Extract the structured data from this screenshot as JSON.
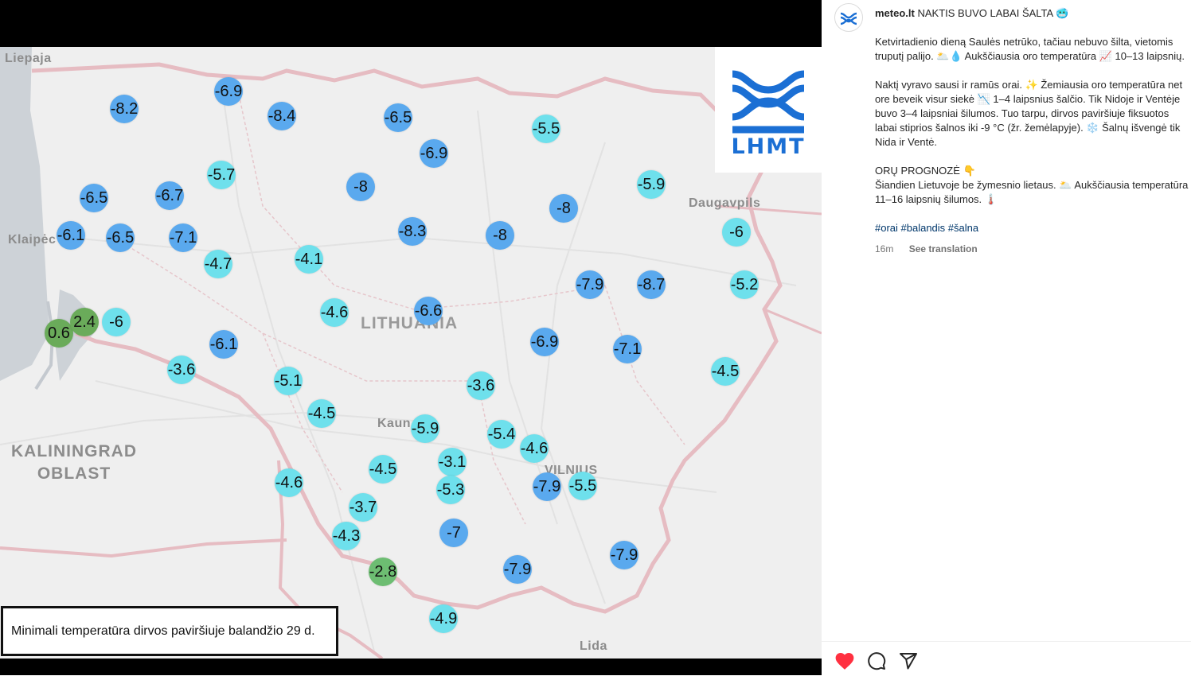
{
  "map": {
    "places": {
      "liepaja": "Liepaja",
      "klaipeda": "Klaipėc",
      "lithuania": "LITHUANIA",
      "kaunas": "Kaun",
      "vilnius": "VILNIUS",
      "daugavpils": "Daugavpils",
      "lida": "Lida",
      "kaliningrad_1": "KALININGRAD",
      "kaliningrad_2": "OBLAST"
    },
    "logo_text": "LHMT",
    "caption": "Minimali temperatūra dirvos paviršiuje balandžio 29 d.",
    "temperatures": [
      "-8.2",
      "-6.9",
      "-8.4",
      "-6.5",
      "-5.5",
      "-6.9",
      "-5.7",
      "-6.5",
      "-6.7",
      "-8",
      "-8",
      "-5.9",
      "-6.1",
      "-6.5",
      "-7.1",
      "-8.3",
      "-8",
      "-6",
      "-4.7",
      "-4.1",
      "-7.9",
      "-8.7",
      "-5.2",
      "-4.6",
      "-6.6",
      "0.6",
      "2.4",
      "-6",
      "-6.1",
      "-6.9",
      "-7.1",
      "-3.6",
      "-5.1",
      "-3.6",
      "-4.5",
      "-4.5",
      "-5.9",
      "-5.4",
      "-4.6",
      "-3.1",
      "-4.5",
      "-4.6",
      "-7.9",
      "-5.5",
      "-5.3",
      "-3.7",
      "-4.3",
      "-7",
      "-7.9",
      "-2.8",
      "-7.9",
      "-4.9"
    ]
  },
  "post": {
    "username": "meteo.lt",
    "headline": "NAKTIS BUVO LABAI ŠALTA 🥶",
    "paragraph_1": "Ketvirtadienio dieną Saulės netrūko, tačiau nebuvo šilta, vietomis truputį palijo. 🌥️💧 Aukščiausia oro temperatūra 📈 10–13 laipsnių.",
    "paragraph_2": "Naktį vyravo sausi ir ramūs orai. ✨ Žemiausia oro temperatūra net ore beveik visur siekė 📉 1–4 laipsnius šalčio. Tik Nidoje ir Ventėje buvo 3–4 laipsniai šilumos. Tuo tarpu, dirvos paviršiuje fiksuotos labai stiprios šalnos iki -9 °C (žr. žemėlapyje). ❄️ Šalnų išvengė tik Nida ir Ventė.",
    "forecast_title": "ORŲ PROGNOZĖ 👇",
    "forecast_text": "Šiandien Lietuvoje be žymesnio lietaus. 🌥️ Aukščiausia temperatūra 11–16 laipsnių šilumos. 🌡️",
    "hashtags": "#orai #balandis #šalna",
    "time_ago": "16m",
    "see_translation": "See translation"
  },
  "icons": {
    "like": "heart-icon",
    "comment": "comment-icon",
    "share": "share-icon",
    "avatar": "meteo-logo-icon"
  },
  "colors": {
    "marker_dark": "#5aa9ee",
    "marker_light": "#6ee0ec",
    "marker_positive": "#6aab5a",
    "like_red": "#ff3040",
    "brand_blue": "#1b6fd4"
  }
}
